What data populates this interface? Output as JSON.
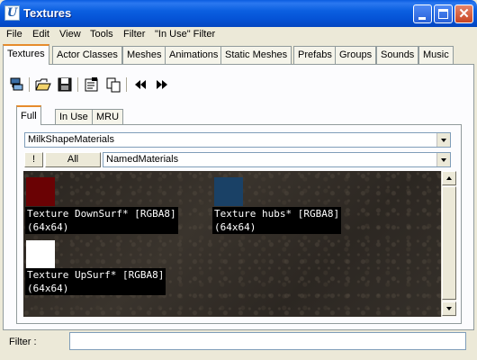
{
  "window": {
    "title": "Textures",
    "app_icon": "unrealed-icon",
    "app_icon_glyph": "U"
  },
  "menu": [
    "File",
    "Edit",
    "View",
    "Tools",
    "Filter",
    "\"In Use\" Filter"
  ],
  "main_tabs": [
    "Textures",
    "Actor Classes",
    "Meshes",
    "Animations",
    "Static Meshes",
    "Prefabs",
    "Groups",
    "Sounds",
    "Music"
  ],
  "active_main_tab": "Textures",
  "toolbar": {
    "icons": [
      "browser-icon",
      "open-folder-icon",
      "save-disk-icon",
      "properties-icon",
      "copy-icon",
      "rewind-icon",
      "fast-forward-icon"
    ]
  },
  "sub_tabs": [
    "Full",
    "In Use",
    "MRU"
  ],
  "active_sub_tab": "Full",
  "package_combo": {
    "value": "MilkShapeMaterials"
  },
  "group_row": {
    "exclaim_label": "!",
    "all_label": "All",
    "group_combo_value": "NamedMaterials"
  },
  "textures": [
    {
      "line1": "Texture DownSurf* [RGBA8]",
      "line2": "(64x64)",
      "color": "#6a0204"
    },
    {
      "line1": "Texture hubs* [RGBA8]",
      "line2": "(64x64)",
      "color": "#1a4166"
    },
    {
      "line1": "Texture UpSurf* [RGBA8]",
      "line2": "(64x64)",
      "color": "#ffffff"
    }
  ],
  "filter": {
    "label": "Filter :",
    "value": "",
    "placeholder": ""
  },
  "colors": {
    "titlebar": "#0553d6",
    "face": "#ece9d8",
    "active_tab_accent": "#e68b2c"
  }
}
